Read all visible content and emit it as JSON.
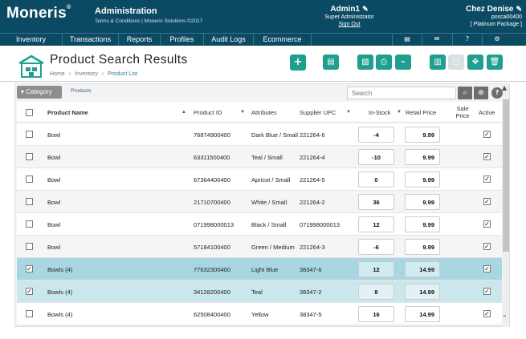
{
  "header": {
    "logo_text": "Moneris",
    "app_title": "Administration",
    "app_subtitle": "Terms & Conditions | Moneris Solutions ©2017",
    "user_name": "Admin1",
    "user_role": "Super Administrator",
    "sign_out": "Sign Out",
    "store_name": "Chez Denise",
    "store_code": "posca00400",
    "store_package": "[ Platinum Package ]"
  },
  "nav": {
    "items": [
      "Inventory",
      "Transactions",
      "Reports",
      "Profiles",
      "Audit Logs",
      "Ecommerce"
    ],
    "icons": [
      "printer-icon",
      "mail-icon",
      "help-icon",
      "settings-icon"
    ]
  },
  "page": {
    "title": "Product Search Results",
    "breadcrumb": [
      "Home",
      "Inventory",
      "Product List"
    ],
    "toolbar_icons": [
      "add-icon",
      "printer-icon",
      "export-icon",
      "print-icon",
      "pin-icon",
      "barcode-icon",
      "disabled-icon",
      "move-icon",
      "delete-icon"
    ]
  },
  "panel": {
    "category_label": "Category",
    "products_tab": "Products",
    "search_placeholder": "Search"
  },
  "table": {
    "headers": {
      "name": "Product Name",
      "id": "Product ID",
      "attributes": "Attributes",
      "upc": "Supplier UPC",
      "stock": "In-Stock",
      "price": "Retail Price",
      "sale": "Sale Price",
      "active": "Active"
    },
    "rows": [
      {
        "checked": false,
        "name": "Bowl",
        "id": "76874900400",
        "attr": "Dark Blue / Small",
        "upc": "221264-6",
        "stock": "-4",
        "price": "9.99",
        "active": true
      },
      {
        "checked": false,
        "name": "Bowl",
        "id": "63311500400",
        "attr": "Teal / Small",
        "upc": "221264-4",
        "stock": "-10",
        "price": "9.99",
        "active": true
      },
      {
        "checked": false,
        "name": "Bowl",
        "id": "67364400400",
        "attr": "Apricot / Small",
        "upc": "221264-5",
        "stock": "0",
        "price": "9.99",
        "active": true
      },
      {
        "checked": false,
        "name": "Bowl",
        "id": "21710700400",
        "attr": "White / Small",
        "upc": "221264-2",
        "stock": "36",
        "price": "9.99",
        "active": true
      },
      {
        "checked": false,
        "name": "Bowl",
        "id": "071998000013",
        "attr": "Black / Small",
        "upc": "071998000013",
        "stock": "12",
        "price": "9.99",
        "active": true
      },
      {
        "checked": false,
        "name": "Bowl",
        "id": "57184100400",
        "attr": "Green / Medium",
        "upc": "221264-3",
        "stock": "-6",
        "price": "9.99",
        "active": true
      },
      {
        "checked": true,
        "name": "Bowls (4)",
        "id": "77632300400",
        "attr": "Light Blue",
        "upc": "38347-6",
        "stock": "12",
        "price": "14.99",
        "active": true
      },
      {
        "checked": true,
        "name": "Bowls (4)",
        "id": "34128200400",
        "attr": "Teal",
        "upc": "38347-2",
        "stock": "8",
        "price": "14.99",
        "active": true
      },
      {
        "checked": false,
        "name": "Bowls (4)",
        "id": "62508400400",
        "attr": "Yellow",
        "upc": "38347-5",
        "stock": "16",
        "price": "14.99",
        "active": true
      }
    ]
  },
  "colors": {
    "header_bg": "#0b4a63",
    "accent": "#1fa08f",
    "selected_row": "#a9d7e1"
  }
}
